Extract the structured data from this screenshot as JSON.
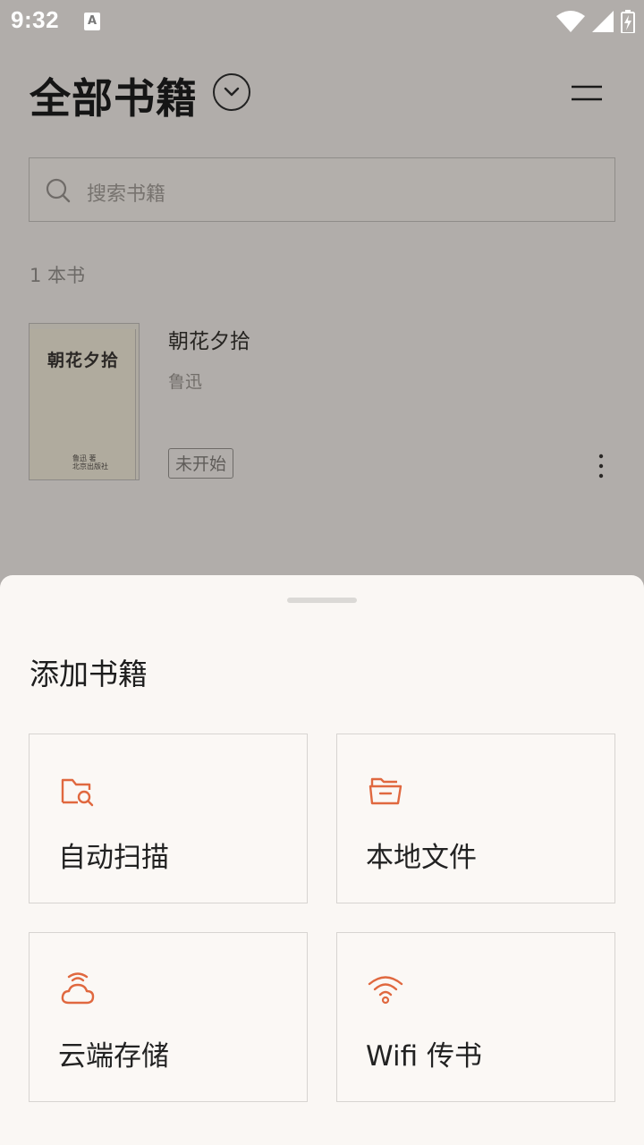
{
  "status_bar": {
    "time": "9:32",
    "notification_glyph": "A"
  },
  "header": {
    "title": "全部书籍"
  },
  "search": {
    "placeholder": "搜索书籍"
  },
  "library": {
    "count_label": "1 本书",
    "books": [
      {
        "title": "朝花夕拾",
        "author": "鲁迅",
        "status": "未开始",
        "cover_title": "朝花夕拾",
        "cover_small_line1": "鲁迅 著",
        "cover_small_line2": "北京出版社"
      }
    ]
  },
  "sheet": {
    "title": "添加书籍",
    "options": [
      {
        "label": "自动扫描",
        "icon": "folder-search-icon"
      },
      {
        "label": "本地文件",
        "icon": "open-folder-icon"
      },
      {
        "label": "云端存储",
        "icon": "cloud-icon"
      },
      {
        "label": "Wifi 传书",
        "icon": "wifi-icon"
      }
    ]
  },
  "colors": {
    "accent": "#e0683f",
    "scrim": "#b1adaa",
    "sheet_bg": "#faf7f4"
  }
}
